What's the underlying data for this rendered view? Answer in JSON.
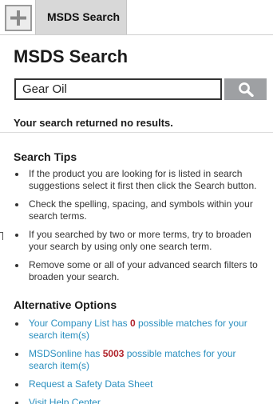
{
  "header": {
    "add_tab_icon": "plus-icon",
    "active_tab_label": "MSDS Search"
  },
  "page": {
    "title": "MSDS Search"
  },
  "search": {
    "value": "Gear Oil",
    "button_icon": "magnifier-icon"
  },
  "results": {
    "message": "Your search returned no results."
  },
  "search_tips": {
    "heading": "Search Tips",
    "items": [
      "If the product you are looking for is listed in search suggestions select it first then click the Search button.",
      "Check the spelling, spacing, and symbols within your search terms.",
      "If you searched by two or more terms, try to broaden your search by using only one search term.",
      "Remove some or all of your advanced search filters to broaden your search."
    ]
  },
  "alternative_options": {
    "heading": "Alternative Options",
    "company_list": {
      "prefix": "Your Company List has ",
      "count": "0",
      "suffix": " possible matches for your search item(s)"
    },
    "msdsonline": {
      "prefix": "MSDSonline has ",
      "count": "5003",
      "suffix": " possible matches for your search item(s)"
    },
    "request_sds": "Request a Safety Data Sheet",
    "help_center": "Visit Help Center"
  },
  "colors": {
    "link": "#2a8fbf",
    "count_highlight": "#b0222a",
    "search_button": "#9ea0a3",
    "active_tab": "#d8d8d8"
  }
}
